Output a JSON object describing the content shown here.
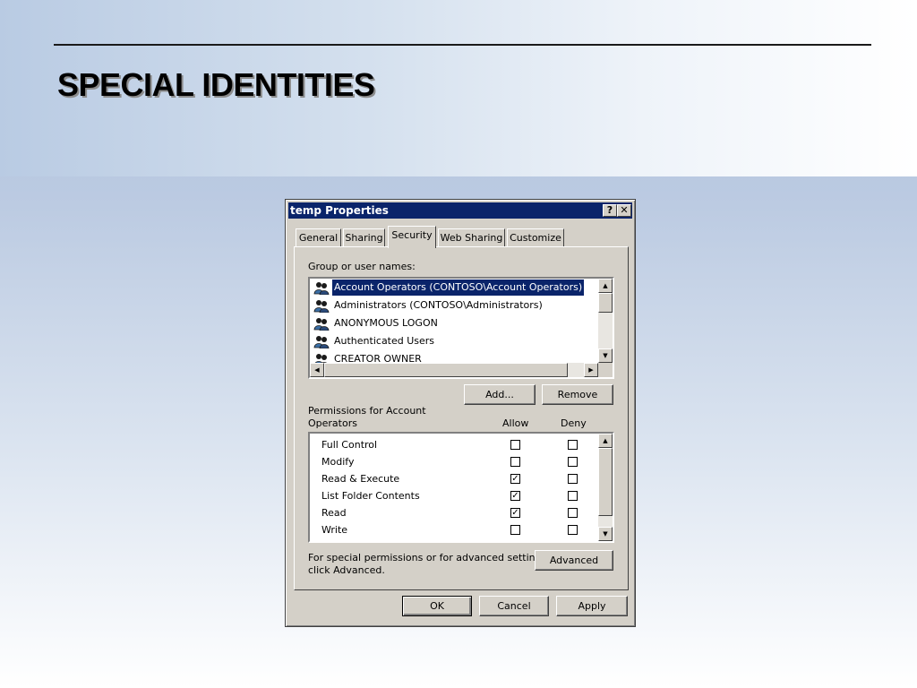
{
  "slide": {
    "title": "SPECIAL IDENTITIES"
  },
  "dialog": {
    "title": "temp Properties",
    "help_label": "?",
    "close_label": "✕",
    "tabs": [
      "General",
      "Sharing",
      "Security",
      "Web Sharing",
      "Customize"
    ],
    "active_tab": "Security",
    "group_label": "Group or user names:",
    "groups": [
      "Account Operators (CONTOSO\\Account Operators)",
      "Administrators (CONTOSO\\Administrators)",
      "ANONYMOUS LOGON",
      "Authenticated Users",
      "CREATOR OWNER"
    ],
    "selected_group": "Account Operators (CONTOSO\\Account Operators)",
    "add_label": "Add...",
    "remove_label": "Remove",
    "permissions_label_line1": "Permissions for Account",
    "permissions_label_line2": "Operators",
    "allow_header": "Allow",
    "deny_header": "Deny",
    "permissions": [
      {
        "name": "Full Control",
        "allow": false,
        "deny": false
      },
      {
        "name": "Modify",
        "allow": false,
        "deny": false
      },
      {
        "name": "Read & Execute",
        "allow": true,
        "deny": false
      },
      {
        "name": "List Folder Contents",
        "allow": true,
        "deny": false
      },
      {
        "name": "Read",
        "allow": true,
        "deny": false
      },
      {
        "name": "Write",
        "allow": false,
        "deny": false
      }
    ],
    "advanced_note_line1": "For special permissions or for advanced settings,",
    "advanced_note_line2": "click Advanced.",
    "advanced_label": "Advanced",
    "ok_label": "OK",
    "cancel_label": "Cancel",
    "apply_label": "Apply",
    "colors": {
      "titlebar": "#0a246a",
      "face": "#d4d0c8",
      "selection": "#0a246a"
    },
    "icons": {
      "group": "user-group-icon",
      "scroll_up": "scroll-up-arrow-icon",
      "scroll_down": "scroll-down-arrow-icon",
      "scroll_left": "scroll-left-arrow-icon",
      "scroll_right": "scroll-right-arrow-icon",
      "checkmark": "checkmark-icon"
    }
  }
}
